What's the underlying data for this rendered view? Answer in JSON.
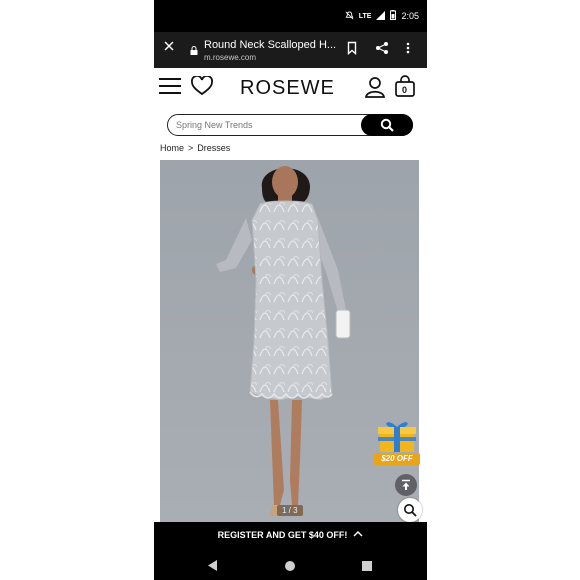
{
  "status_bar": {
    "network": "LTE",
    "time": "2:05",
    "icons": [
      "mute-icon",
      "signal-icon",
      "battery-icon"
    ]
  },
  "browser": {
    "page_title": "Round Neck Scalloped H...",
    "url": "m.rosewe.com",
    "icons": [
      "close-icon",
      "lock-icon",
      "bookmark-icon",
      "share-icon",
      "more-vert-icon"
    ]
  },
  "header": {
    "logo": "ROSEWE",
    "icons": [
      "menu-icon",
      "heart-icon",
      "user-icon",
      "bag-icon"
    ],
    "bag_count": "0"
  },
  "search": {
    "placeholder": "Spring New Trends",
    "value": ""
  },
  "breadcrumb": {
    "items": [
      "Home",
      "Dresses"
    ],
    "separator": ">"
  },
  "gallery": {
    "counter": "1 / 3",
    "background_color": "#9aa0a7",
    "dress_color": "#c9ccd1"
  },
  "gift_badge": {
    "label": "$20 OFF"
  },
  "register_bar": {
    "label": "REGISTER AND GET $40 OFF!"
  },
  "colors": {
    "bar_background": "#000000",
    "browser_background": "#1b1b1b",
    "accent_gift": "#f2b51c"
  }
}
